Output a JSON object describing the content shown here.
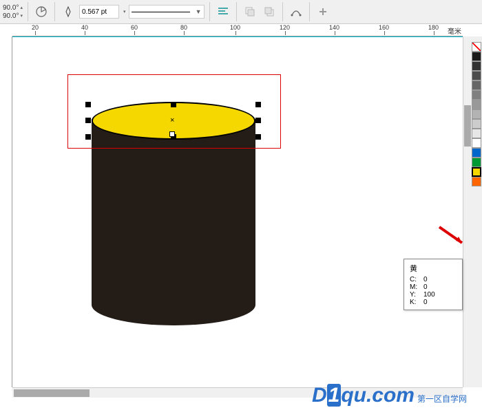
{
  "toolbar": {
    "x_value": "90.0",
    "y_value": "90.0",
    "degree_symbol": "°",
    "outline_width": "0.567 pt"
  },
  "ruler": {
    "unit": "毫米",
    "ticks": [
      "20",
      "40",
      "60",
      "80",
      "100",
      "120",
      "140",
      "160",
      "180"
    ]
  },
  "tooltip": {
    "title": "黄",
    "c_label": "C:",
    "c_value": "0",
    "m_label": "M:",
    "m_value": "0",
    "y_label": "Y:",
    "y_value": "100",
    "k_label": "K:",
    "k_value": "0"
  },
  "palette": [
    {
      "color": "none"
    },
    {
      "color": "#1a1a1a"
    },
    {
      "color": "#333333"
    },
    {
      "color": "#4d4d4d"
    },
    {
      "color": "#666666"
    },
    {
      "color": "#808080"
    },
    {
      "color": "#999999"
    },
    {
      "color": "#b3b3b3"
    },
    {
      "color": "#cccccc"
    },
    {
      "color": "#e6e6e6"
    },
    {
      "color": "#ffffff"
    },
    {
      "color": "#0066cc"
    },
    {
      "color": "#009933"
    },
    {
      "color": "#f5d800",
      "selected": true
    },
    {
      "color": "#ff6600"
    }
  ],
  "watermark": {
    "brand_d": "D",
    "brand_1": "1",
    "brand_domain": "qu.com",
    "sub": "第一区自学网"
  }
}
